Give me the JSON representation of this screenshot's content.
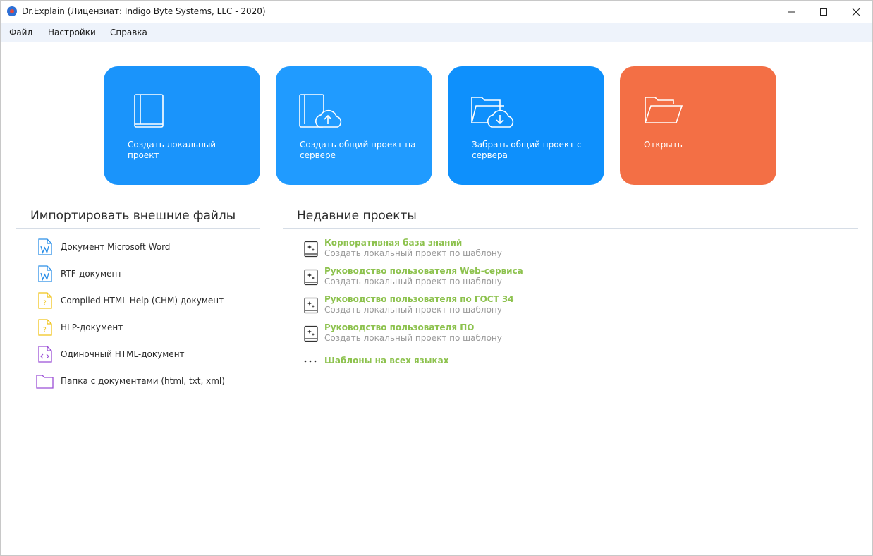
{
  "window": {
    "title": "Dr.Explain (Лицензиат: Indigo Byte Systems, LLC - 2020)"
  },
  "menu": {
    "file": "Файл",
    "settings": "Настройки",
    "help": "Справка"
  },
  "tiles": [
    {
      "label": "Создать локальный проект",
      "icon": "book-icon",
      "color": "#1a94fb"
    },
    {
      "label": "Создать общий проект на сервере",
      "icon": "book-cloud-upload-icon",
      "color": "#209bff"
    },
    {
      "label": "Забрать общий проект с сервера",
      "icon": "folder-cloud-download-icon",
      "color": "#0e90fc"
    },
    {
      "label": "Открыть",
      "icon": "open-folder-icon",
      "color": "#f36f45"
    }
  ],
  "import": {
    "title": "Импортировать внешние файлы",
    "items": [
      {
        "label": "Документ Microsoft Word",
        "icon": "word-doc-icon"
      },
      {
        "label": "RTF-документ",
        "icon": "rtf-doc-icon"
      },
      {
        "label": "Compiled HTML Help (CHM) документ",
        "icon": "chm-help-icon"
      },
      {
        "label": "HLP-документ",
        "icon": "hlp-help-icon"
      },
      {
        "label": "Одиночный HTML-документ",
        "icon": "html-doc-icon"
      },
      {
        "label": "Папка с документами (html, txt, xml)",
        "icon": "folder-icon"
      }
    ]
  },
  "recent": {
    "title": "Недавние проекты",
    "items": [
      {
        "name": "Корпоративная база знаний",
        "subtitle": "Создать локальный проект по шаблону"
      },
      {
        "name": "Руководство пользователя Web-сервиса",
        "subtitle": "Создать локальный проект по шаблону"
      },
      {
        "name": "Руководство пользователя по ГОСТ 34",
        "subtitle": "Создать локальный проект по шаблону"
      },
      {
        "name": "Руководство пользователя ПО",
        "subtitle": "Создать локальный проект по шаблону"
      }
    ],
    "more_label": "Шаблоны на всех языках",
    "more_icon": "more-dots-icon"
  },
  "colors": {
    "accent_green": "#8dc24e",
    "word_blue": "#2b8fe8",
    "help_yellow": "#f0c419",
    "html_purple": "#9b4fd6"
  }
}
